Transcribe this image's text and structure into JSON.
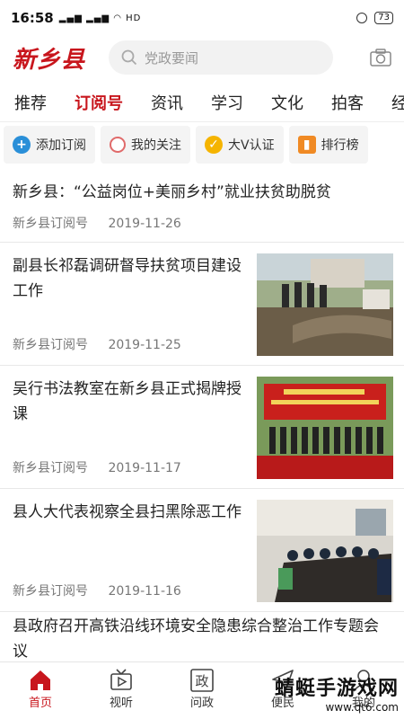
{
  "statusbar": {
    "time": "16:58",
    "signal": "4G 4G",
    "battery": "73"
  },
  "header": {
    "logo": "新乡县",
    "search_placeholder": "党政要闻"
  },
  "tabs": [
    "推荐",
    "订阅号",
    "资讯",
    "学习",
    "文化",
    "拍客",
    "经"
  ],
  "active_tab": "订阅号",
  "shortcuts": [
    {
      "label": "添加订阅",
      "icon": "plus-icon",
      "color": "#2a8fd8"
    },
    {
      "label": "我的关注",
      "icon": "circle-icon",
      "color": "#e06a6a"
    },
    {
      "label": "大V认证",
      "icon": "v-badge-icon",
      "color": "#f5b400"
    },
    {
      "label": "排行榜",
      "icon": "chart-icon",
      "color": "#f08a24"
    }
  ],
  "news": [
    {
      "title": "新乡县：“公益岗位+美丽乡村”就业扶贫助脱贫",
      "source": "新乡县订阅号",
      "date": "2019-11-26"
    },
    {
      "title": "副县长祁磊调研督导扶贫项目建设工作",
      "source": "新乡县订阅号",
      "date": "2019-11-25"
    },
    {
      "title": "吴行书法教室在新乡县正式揭牌授课",
      "source": "新乡县订阅号",
      "date": "2019-11-17"
    },
    {
      "title": "县人大代表视察全县扫黑除恶工作",
      "source": "新乡县订阅号",
      "date": "2019-11-16"
    },
    {
      "title": "县政府召开高铁沿线环境安全隐患综合整治工作专题会议",
      "source": "",
      "date": ""
    }
  ],
  "bottom_nav": [
    {
      "label": "首页",
      "icon": "home-icon"
    },
    {
      "label": "视听",
      "icon": "tv-icon"
    },
    {
      "label": "问政",
      "icon": "zheng-icon"
    },
    {
      "label": "便民",
      "icon": "send-icon"
    },
    {
      "label": "我的",
      "icon": "user-icon"
    }
  ],
  "watermark": {
    "line1": "蜻蜓手游戏网",
    "line2": "www.qt6.com"
  },
  "colors": {
    "accent": "#c8161d"
  }
}
